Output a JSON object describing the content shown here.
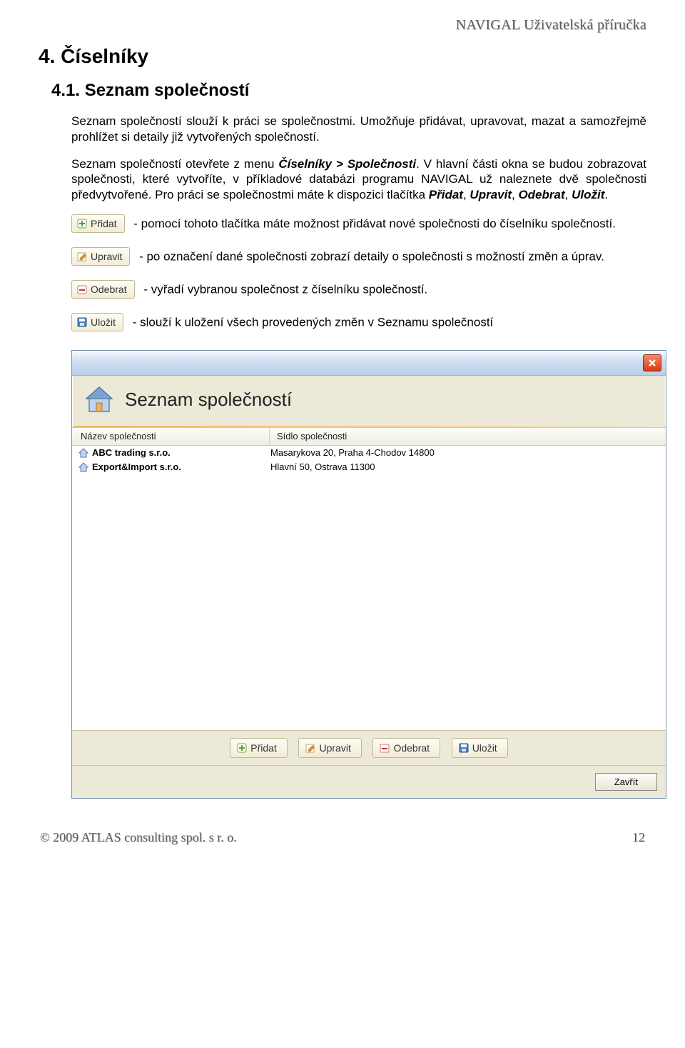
{
  "header_right": "NAVIGAL    Uživatelská příručka",
  "h1": "4. Číselníky",
  "h2": "4.1. Seznam společností",
  "para1": "Seznam společností slouží k práci se společnostmi. Umožňuje přidávat, upravovat, mazat a samozřejmě prohlížet si detaily již vytvořených společností.",
  "para2_a": "Seznam společností otevřete z menu ",
  "para2_menu": "Číselníky > Společnosti",
  "para2_b": ". V hlavní části okna se budou zobrazovat společnosti, které vytvoříte, v příkladové databázi programu NAVIGAL už naleznete dvě společnosti předvytvořené. Pro práci se společnostmi máte k dispozici tlačítka ",
  "btn_names": {
    "add": "Přidat",
    "edit": "Upravit",
    "del": "Odebrat",
    "save": "Uložit"
  },
  "desc_add_a": " - pomocí tohoto tlačítka máte možnost přidávat nové společnosti do číselníku společností.",
  "desc_edit": " - po označení dané společnosti zobrazí detaily o společnosti s možností změn a úprav.",
  "desc_del": " - vyřadí vybranou společnost z číselníku společností.",
  "desc_save": " - slouží k uložení všech provedených změn v Seznamu společností",
  "window": {
    "title": "Seznam společností",
    "col1": "Název společnosti",
    "col2": "Sídlo společnosti",
    "rows": [
      {
        "name": "ABC trading s.r.o.",
        "addr": "Masarykova 20, Praha 4-Chodov 14800"
      },
      {
        "name": "Export&Import s.r.o.",
        "addr": "Hlavní 50, Ostrava 11300"
      }
    ],
    "close_label": "Zavřít"
  },
  "footer_left": "© 2009  ATLAS consulting spol. s r. o.",
  "footer_right": "12"
}
